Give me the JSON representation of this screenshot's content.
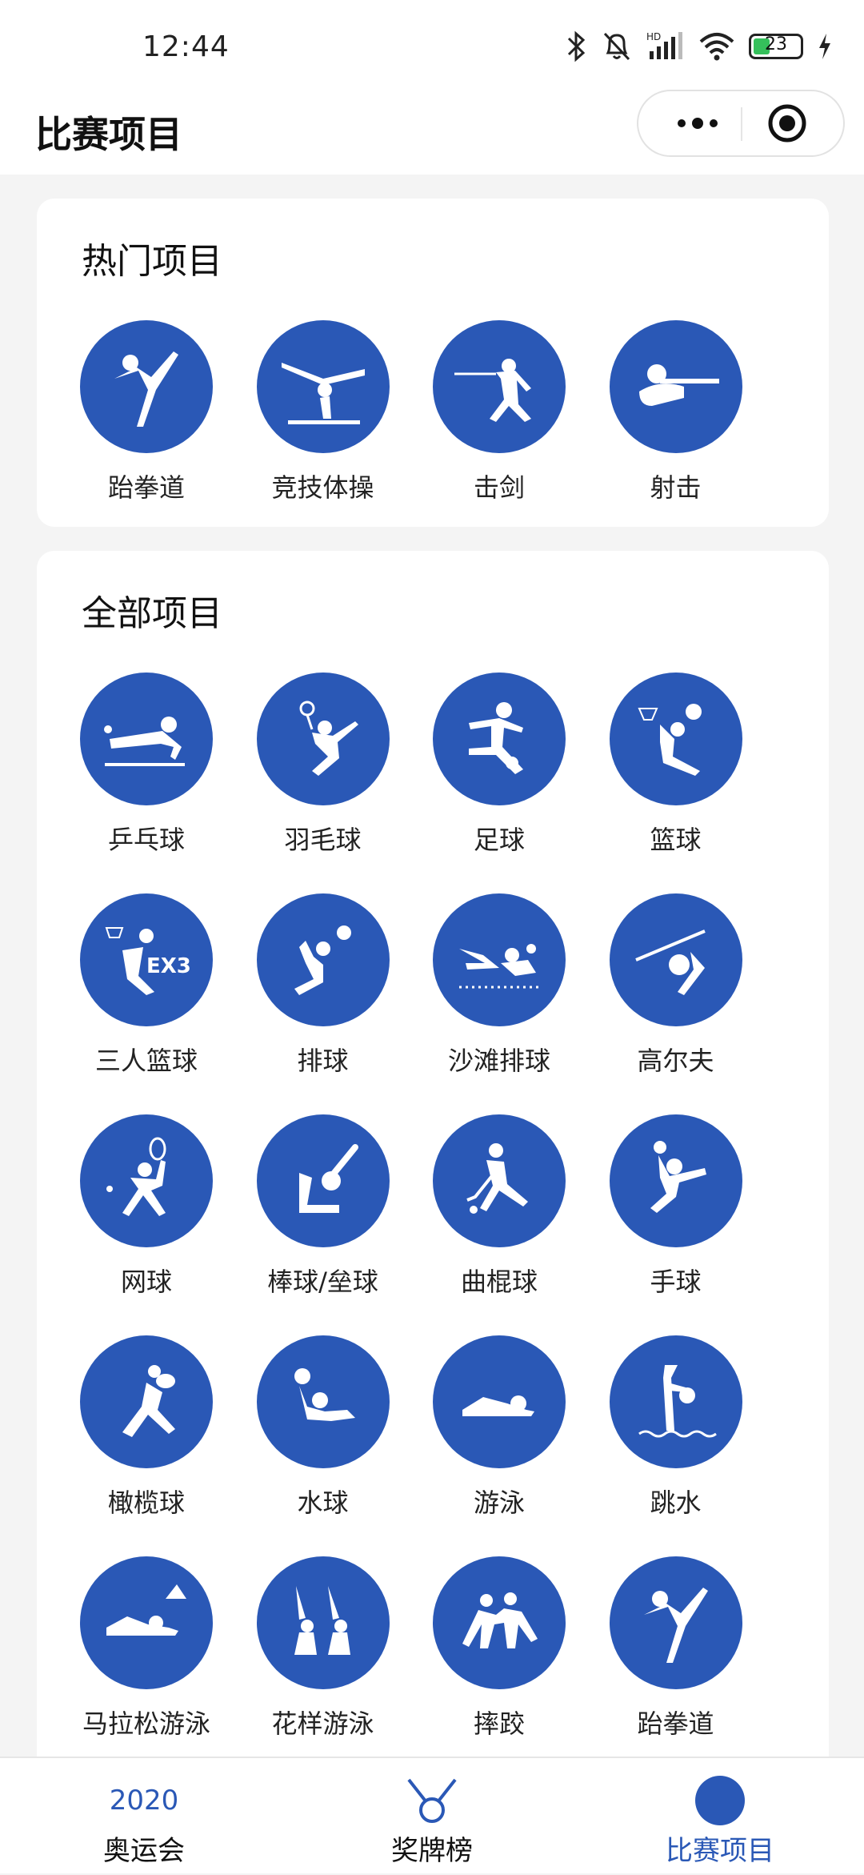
{
  "status_bar": {
    "time": "12:44",
    "battery": "23",
    "icons": [
      "bluetooth-icon",
      "mute-bell-icon",
      "hd-signal-icon",
      "wifi-icon",
      "battery-icon",
      "charging-icon"
    ]
  },
  "navbar": {
    "title": "比赛项目",
    "icons": [
      "more-icon",
      "target-icon"
    ]
  },
  "hot": {
    "title": "热门项目",
    "items": [
      {
        "label": "跆拳道",
        "icon": "taekwondo-icon"
      },
      {
        "label": "竞技体操",
        "icon": "gymnastics-icon"
      },
      {
        "label": "击剑",
        "icon": "fencing-icon"
      },
      {
        "label": "射击",
        "icon": "shooting-icon"
      }
    ]
  },
  "all": {
    "title": "全部项目",
    "items": [
      {
        "label": "乒乓球",
        "icon": "table-tennis-icon"
      },
      {
        "label": "羽毛球",
        "icon": "badminton-icon"
      },
      {
        "label": "足球",
        "icon": "football-icon"
      },
      {
        "label": "篮球",
        "icon": "basketball-icon"
      },
      {
        "label": "三人篮球",
        "icon": "basketball-3x3-icon"
      },
      {
        "label": "排球",
        "icon": "volleyball-icon"
      },
      {
        "label": "沙滩排球",
        "icon": "beach-volleyball-icon"
      },
      {
        "label": "高尔夫",
        "icon": "golf-icon"
      },
      {
        "label": "网球",
        "icon": "tennis-icon"
      },
      {
        "label": "棒球/垒球",
        "icon": "baseball-icon"
      },
      {
        "label": "曲棍球",
        "icon": "hockey-icon"
      },
      {
        "label": "手球",
        "icon": "handball-icon"
      },
      {
        "label": "橄榄球",
        "icon": "rugby-icon"
      },
      {
        "label": "水球",
        "icon": "water-polo-icon"
      },
      {
        "label": "游泳",
        "icon": "swimming-icon"
      },
      {
        "label": "跳水",
        "icon": "diving-icon"
      },
      {
        "label": "马拉松游泳",
        "icon": "marathon-swimming-icon"
      },
      {
        "label": "花样游泳",
        "icon": "artistic-swimming-icon"
      },
      {
        "label": "摔跤",
        "icon": "wrestling-icon"
      },
      {
        "label": "跆拳道",
        "icon": "taekwondo-icon"
      }
    ]
  },
  "tabbar": {
    "tabs": [
      {
        "label": "奥运会",
        "icon_text": "2020",
        "icon": "olympics-2020-icon",
        "active": false
      },
      {
        "label": "奖牌榜",
        "icon": "medal-icon",
        "active": false
      },
      {
        "label": "比赛项目",
        "icon": "sports-circle-icon",
        "active": true
      }
    ]
  },
  "colors": {
    "accent": "#2a58b6",
    "background": "#f4f4f4",
    "card": "#ffffff"
  }
}
